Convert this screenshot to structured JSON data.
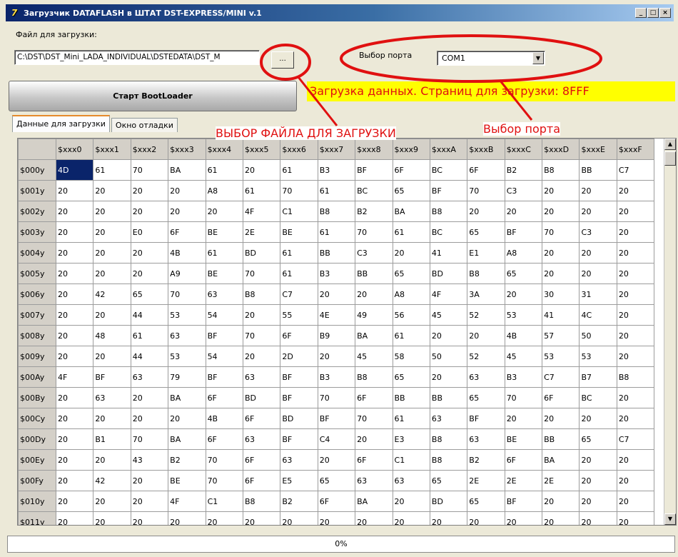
{
  "window": {
    "title": "Загрузчик DATAFLASH в ШТАТ DST-EXPRESS/MINI v.1",
    "icon_text": "7",
    "minimize": "_",
    "maximize": "□",
    "close": "×"
  },
  "file": {
    "label": "Файл для загрузки:",
    "path": "C:\\DST\\DST_Mini_LADA_INDIVIDUAL\\DSTEDATA\\DST_M",
    "browse_label": "..."
  },
  "port": {
    "label": "Выбор порта",
    "selected": "COM1"
  },
  "start_button": "Старт BootLoader",
  "status_banner": "Загрузка данных. Страниц для загрузки: 8FFF",
  "annotations": {
    "file_choice": "ВЫБОР ФАЙЛА ДЛЯ ЗАГРУЗКИ",
    "port_choice": "Выбор порта",
    "color": "#e01010"
  },
  "tabs": [
    {
      "label": "Данные для загрузки",
      "active": true
    },
    {
      "label": "Окно отладки",
      "active": false
    }
  ],
  "grid": {
    "columns": [
      "$xxx0",
      "$xxx1",
      "$xxx2",
      "$xxx3",
      "$xxx4",
      "$xxx5",
      "$xxx6",
      "$xxx7",
      "$xxx8",
      "$xxx9",
      "$xxxA",
      "$xxxB",
      "$xxxC",
      "$xxxD",
      "$xxxE",
      "$xxxF"
    ],
    "rows": [
      {
        "label": "$000y",
        "cells": [
          "4D",
          "61",
          "70",
          "BA",
          "61",
          "20",
          "61",
          "B3",
          "BF",
          "6F",
          "BC",
          "6F",
          "B2",
          "B8",
          "BB",
          "C7"
        ]
      },
      {
        "label": "$001y",
        "cells": [
          "20",
          "20",
          "20",
          "20",
          "A8",
          "61",
          "70",
          "61",
          "BC",
          "65",
          "BF",
          "70",
          "C3",
          "20",
          "20",
          "20"
        ]
      },
      {
        "label": "$002y",
        "cells": [
          "20",
          "20",
          "20",
          "20",
          "20",
          "4F",
          "C1",
          "B8",
          "B2",
          "BA",
          "B8",
          "20",
          "20",
          "20",
          "20",
          "20"
        ]
      },
      {
        "label": "$003y",
        "cells": [
          "20",
          "20",
          "E0",
          "6F",
          "BE",
          "2E",
          "BE",
          "61",
          "70",
          "61",
          "BC",
          "65",
          "BF",
          "70",
          "C3",
          "20"
        ]
      },
      {
        "label": "$004y",
        "cells": [
          "20",
          "20",
          "20",
          "4B",
          "61",
          "BD",
          "61",
          "BB",
          "C3",
          "20",
          "41",
          "E1",
          "A8",
          "20",
          "20",
          "20"
        ]
      },
      {
        "label": "$005y",
        "cells": [
          "20",
          "20",
          "20",
          "A9",
          "BE",
          "70",
          "61",
          "B3",
          "BB",
          "65",
          "BD",
          "B8",
          "65",
          "20",
          "20",
          "20"
        ]
      },
      {
        "label": "$006y",
        "cells": [
          "20",
          "42",
          "65",
          "70",
          "63",
          "B8",
          "C7",
          "20",
          "20",
          "A8",
          "4F",
          "3A",
          "20",
          "30",
          "31",
          "20"
        ]
      },
      {
        "label": "$007y",
        "cells": [
          "20",
          "20",
          "44",
          "53",
          "54",
          "20",
          "55",
          "4E",
          "49",
          "56",
          "45",
          "52",
          "53",
          "41",
          "4C",
          "20"
        ]
      },
      {
        "label": "$008y",
        "cells": [
          "20",
          "48",
          "61",
          "63",
          "BF",
          "70",
          "6F",
          "B9",
          "BA",
          "61",
          "20",
          "20",
          "4B",
          "57",
          "50",
          "20"
        ]
      },
      {
        "label": "$009y",
        "cells": [
          "20",
          "20",
          "44",
          "53",
          "54",
          "20",
          "2D",
          "20",
          "45",
          "58",
          "50",
          "52",
          "45",
          "53",
          "53",
          "20"
        ]
      },
      {
        "label": "$00Ay",
        "cells": [
          "4F",
          "BF",
          "63",
          "79",
          "BF",
          "63",
          "BF",
          "B3",
          "B8",
          "65",
          "20",
          "63",
          "B3",
          "C7",
          "B7",
          "B8"
        ]
      },
      {
        "label": "$00By",
        "cells": [
          "20",
          "63",
          "20",
          "BA",
          "6F",
          "BD",
          "BF",
          "70",
          "6F",
          "BB",
          "BB",
          "65",
          "70",
          "6F",
          "BC",
          "20"
        ]
      },
      {
        "label": "$00Cy",
        "cells": [
          "20",
          "20",
          "20",
          "20",
          "4B",
          "6F",
          "BD",
          "BF",
          "70",
          "61",
          "63",
          "BF",
          "20",
          "20",
          "20",
          "20"
        ]
      },
      {
        "label": "$00Dy",
        "cells": [
          "20",
          "B1",
          "70",
          "BA",
          "6F",
          "63",
          "BF",
          "C4",
          "20",
          "E3",
          "B8",
          "63",
          "BE",
          "BB",
          "65",
          "C7"
        ]
      },
      {
        "label": "$00Ey",
        "cells": [
          "20",
          "20",
          "43",
          "B2",
          "70",
          "6F",
          "63",
          "20",
          "6F",
          "C1",
          "B8",
          "B2",
          "6F",
          "BA",
          "20",
          "20"
        ]
      },
      {
        "label": "$00Fy",
        "cells": [
          "20",
          "42",
          "20",
          "BE",
          "70",
          "6F",
          "E5",
          "65",
          "63",
          "63",
          "65",
          "2E",
          "2E",
          "2E",
          "20",
          "20"
        ]
      },
      {
        "label": "$010y",
        "cells": [
          "20",
          "20",
          "20",
          "4F",
          "C1",
          "B8",
          "B2",
          "6F",
          "BA",
          "20",
          "BD",
          "65",
          "BF",
          "20",
          "20",
          "20"
        ]
      },
      {
        "label": "$011y",
        "cells": [
          "20",
          "20",
          "20",
          "20",
          "20",
          "20",
          "20",
          "20",
          "20",
          "20",
          "20",
          "20",
          "20",
          "20",
          "20",
          "20"
        ]
      }
    ]
  },
  "progress": {
    "text": "0%",
    "value": 0
  }
}
